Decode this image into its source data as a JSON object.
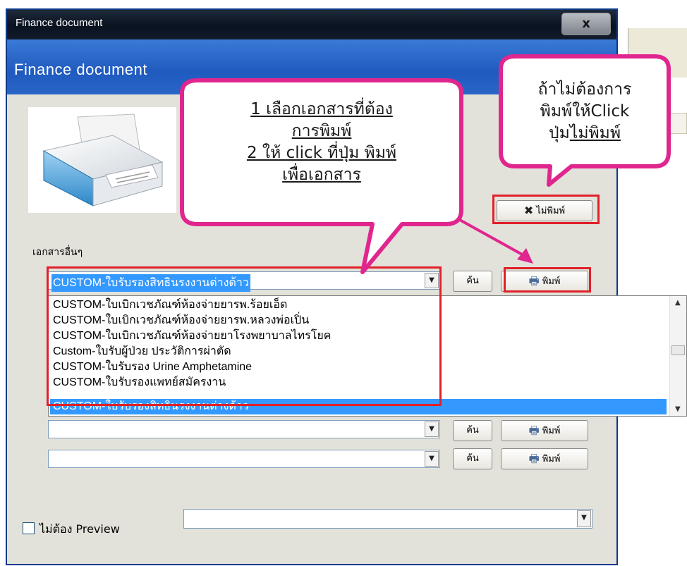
{
  "window": {
    "title": "Finance document",
    "close_label": "x",
    "header_title": "Finance document"
  },
  "form": {
    "other_docs_label": "เอกสารอื่นๆ",
    "selected_doc": "CUSTOM-ใบรับรองสิทธินรงงานต่างด้าว",
    "search_label": "ค้น",
    "print_label": "พิมพ์",
    "no_print_label": "ไม่พิมพ์",
    "no_preview_label": "ไม่ต้อง Preview"
  },
  "dropdown": {
    "items": [
      "CUSTOM-ใบเบิกเวชภัณฑ์ห้องจ่ายยารพ.ร้อยเอ็ด",
      "CUSTOM-ใบเบิกเวชภัณฑ์ห้องจ่ายยารพ.หลวงพ่อเปิ่น",
      "CUSTOM-ใบเบิกเวชภัณฑ์ห้องจ่ายยาโรงพยาบาลไทรโยค",
      "Custom-ใบรับผู้ป่วย ประวัติการผ่าตัด",
      "CUSTOM-ใบรับรอง Urine Amphetamine",
      "CUSTOM-ใบรับรองแพทย์สมัครงาน",
      "CUSTOM-ใบรับรองสิทธินรงงานต่างด้าว"
    ],
    "selected_index": 6
  },
  "callouts": {
    "main": {
      "line1": "1 เลือกเอกสารที่ต้อง",
      "line2": "การพิมพ์",
      "line3": "2 ให้ click ที่ปุ่ม พิมพ์",
      "line4": "เพื่อเอกสาร"
    },
    "side": {
      "line1": "ถ้าไม่ต้องการ",
      "line2": "พิมพ์ให้Click",
      "line3_prefix": "ปุ่ม",
      "line3_link": "ไม่พิมพ์"
    }
  },
  "colors": {
    "header_blue": "#2a66c7",
    "callout_border": "#e0268e",
    "highlight_red": "#e0202a",
    "selection_blue": "#3399ff"
  }
}
